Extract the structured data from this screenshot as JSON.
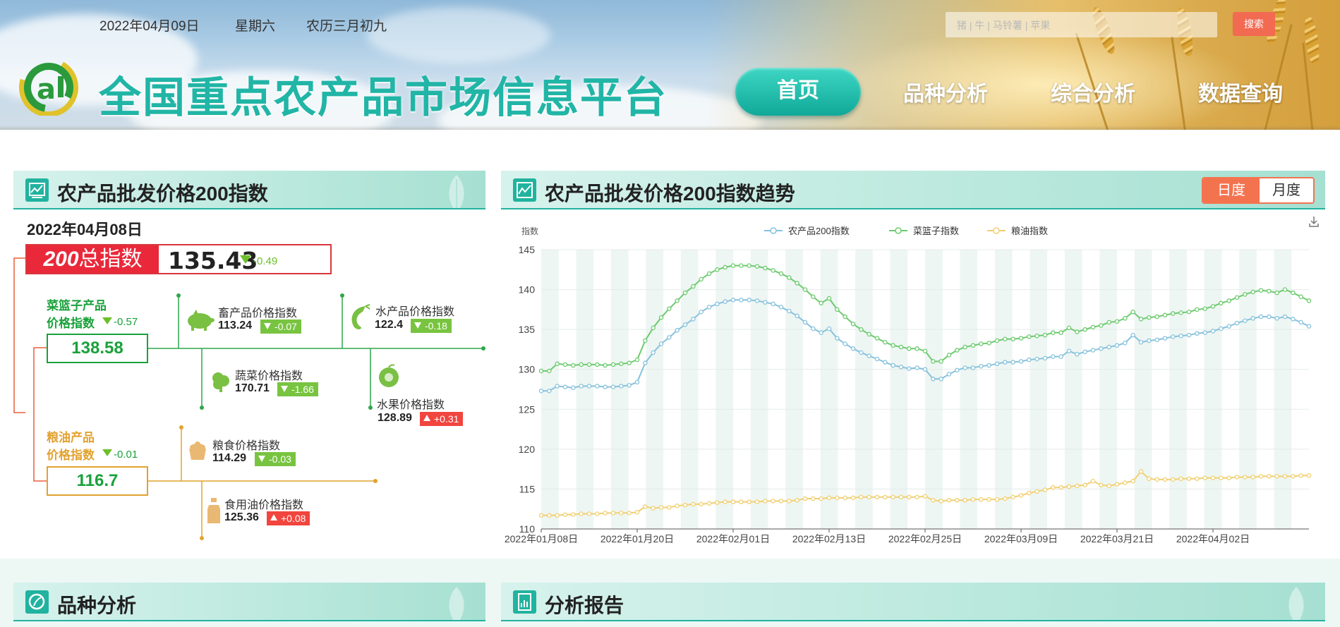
{
  "header": {
    "date": "2022年04月09日",
    "weekday": "星期六",
    "lunar": "农历三月初九",
    "site_title": "全国重点农产品市场信息平台",
    "search": {
      "placeholder": "猪 | 牛 | 马铃薯 | 苹果",
      "button": "搜索"
    },
    "nav": [
      "首页",
      "品种分析",
      "综合分析",
      "数据查询"
    ],
    "active_nav": "首页"
  },
  "index_panel": {
    "title": "农产品批发价格200指数",
    "date": "2022年04月08日",
    "total": {
      "label_num": "200",
      "label_text": "总指数",
      "value": "135.43",
      "change": "-0.49"
    },
    "basket": {
      "title_line1": "菜篮子产品",
      "title_line2": "价格指数",
      "change": "-0.57",
      "value": "138.58",
      "color": "#1aa13b",
      "items": [
        {
          "name": "畜产品价格指数",
          "value": "113.24",
          "change": "-0.07",
          "dir": "down",
          "icon": "pig-icon"
        },
        {
          "name": "水产品价格指数",
          "value": "122.4",
          "change": "-0.18",
          "dir": "down",
          "icon": "shrimp-icon"
        },
        {
          "name": "蔬菜价格指数",
          "value": "170.71",
          "change": "-1.66",
          "dir": "down",
          "icon": "vegetable-icon"
        },
        {
          "name": "水果价格指数",
          "value": "128.89",
          "change": "+0.31",
          "dir": "up",
          "icon": "fruit-icon"
        }
      ]
    },
    "grain": {
      "title_line1": "粮油产品",
      "title_line2": "价格指数",
      "change": "-0.01",
      "value": "116.7",
      "color": "#e2a22f",
      "items": [
        {
          "name": "粮食价格指数",
          "value": "114.29",
          "change": "-0.03",
          "dir": "down",
          "icon": "grain-icon"
        },
        {
          "name": "食用油价格指数",
          "value": "125.36",
          "change": "+0.08",
          "dir": "up",
          "icon": "oil-bottle-icon"
        }
      ]
    }
  },
  "trend_panel": {
    "title": "农产品批发价格200指数趋势",
    "toggle": [
      "日度",
      "月度"
    ],
    "active_toggle": "日度"
  },
  "bottom_panels": [
    {
      "title": "品种分析",
      "icon": "leaf-icon"
    },
    {
      "title": "分析报告",
      "icon": "report-icon"
    }
  ],
  "colors": {
    "accent": "#21b39f",
    "series_200": "#86c2dd",
    "series_basket": "#6ccb6e",
    "series_grain": "#f2cf6f",
    "up": "#f1453e",
    "down": "#78c440"
  },
  "chart_data": {
    "type": "line",
    "ylabel": "指数",
    "ylim": [
      110,
      145
    ],
    "yticks": [
      110,
      115,
      120,
      125,
      130,
      135,
      140,
      145
    ],
    "xtick_labels": [
      "2022年01月08日",
      "2022年01月20日",
      "2022年02月01日",
      "2022年02月13日",
      "2022年02月25日",
      "2022年03月09日",
      "2022年03月21日",
      "2022年04月02日"
    ],
    "x_start": "2022-01-08",
    "x_end": "2022-04-08",
    "legend": "top-center",
    "grid": true,
    "series": [
      {
        "name": "农产品200指数",
        "color": "#86c2dd",
        "values": [
          127.3,
          127.3,
          127.9,
          127.8,
          127.7,
          127.9,
          127.9,
          127.9,
          127.8,
          127.8,
          127.9,
          128.0,
          128.4,
          130.8,
          132.1,
          133.2,
          134.0,
          134.9,
          135.6,
          136.3,
          137.2,
          137.8,
          138.2,
          138.5,
          138.7,
          138.7,
          138.7,
          138.6,
          138.4,
          138.2,
          137.8,
          137.3,
          136.7,
          135.9,
          135.1,
          134.6,
          135.1,
          133.9,
          133.2,
          132.6,
          132.1,
          131.7,
          131.3,
          130.9,
          130.5,
          130.3,
          130.1,
          130.2,
          130.0,
          128.8,
          128.8,
          129.4,
          129.9,
          130.2,
          130.2,
          130.4,
          130.5,
          130.7,
          130.9,
          130.9,
          131.0,
          131.2,
          131.3,
          131.4,
          131.6,
          131.6,
          132.3,
          131.9,
          132.2,
          132.4,
          132.6,
          132.8,
          133.0,
          133.3,
          134.3,
          133.4,
          133.6,
          133.7,
          133.9,
          134.1,
          134.2,
          134.3,
          134.5,
          134.6,
          134.8,
          135.1,
          135.4,
          135.8,
          136.1,
          136.4,
          136.6,
          136.6,
          136.4,
          136.6,
          136.3,
          135.9,
          135.4
        ]
      },
      {
        "name": "菜篮子指数",
        "color": "#6ccb6e",
        "values": [
          129.8,
          129.8,
          130.7,
          130.6,
          130.5,
          130.6,
          130.6,
          130.6,
          130.5,
          130.6,
          130.7,
          130.8,
          131.2,
          133.6,
          135.2,
          136.5,
          137.6,
          138.6,
          139.6,
          140.4,
          141.3,
          142.0,
          142.5,
          142.8,
          143.0,
          143.0,
          143.0,
          142.9,
          142.7,
          142.4,
          142.0,
          141.5,
          140.8,
          140.0,
          139.1,
          138.3,
          138.9,
          137.5,
          136.6,
          135.7,
          135.0,
          134.4,
          133.9,
          133.4,
          133.0,
          132.8,
          132.6,
          132.6,
          132.3,
          131.0,
          131.0,
          131.8,
          132.4,
          132.8,
          133.0,
          133.2,
          133.3,
          133.6,
          133.8,
          133.8,
          133.9,
          134.1,
          134.2,
          134.3,
          134.6,
          134.6,
          135.2,
          134.7,
          135.0,
          135.3,
          135.5,
          135.9,
          136.0,
          136.4,
          137.2,
          136.3,
          136.5,
          136.6,
          136.8,
          137.0,
          137.1,
          137.2,
          137.5,
          137.6,
          137.9,
          138.3,
          138.6,
          139.0,
          139.4,
          139.7,
          139.9,
          139.8,
          139.6,
          140.0,
          139.6,
          139.1,
          138.6
        ]
      },
      {
        "name": "粮油指数",
        "color": "#f2cf6f",
        "values": [
          111.7,
          111.7,
          111.7,
          111.8,
          111.8,
          111.9,
          111.9,
          111.9,
          112.0,
          112.0,
          112.0,
          112.0,
          112.1,
          112.8,
          112.6,
          112.7,
          112.7,
          112.9,
          113.0,
          113.1,
          113.1,
          113.2,
          113.3,
          113.4,
          113.4,
          113.4,
          113.4,
          113.4,
          113.5,
          113.5,
          113.5,
          113.5,
          113.6,
          113.8,
          113.8,
          113.8,
          113.9,
          113.9,
          113.9,
          113.9,
          114.0,
          114.0,
          114.0,
          114.0,
          114.0,
          114.0,
          114.0,
          114.0,
          114.1,
          113.6,
          113.5,
          113.6,
          113.6,
          113.6,
          113.7,
          113.7,
          113.7,
          113.7,
          113.8,
          114.0,
          114.2,
          114.5,
          114.7,
          114.9,
          115.2,
          115.2,
          115.3,
          115.4,
          115.5,
          116.0,
          115.5,
          115.4,
          115.6,
          115.8,
          116.0,
          117.2,
          116.3,
          116.2,
          116.2,
          116.2,
          116.3,
          116.3,
          116.3,
          116.4,
          116.4,
          116.4,
          116.4,
          116.5,
          116.5,
          116.5,
          116.6,
          116.6,
          116.6,
          116.6,
          116.6,
          116.7,
          116.7
        ]
      }
    ]
  }
}
